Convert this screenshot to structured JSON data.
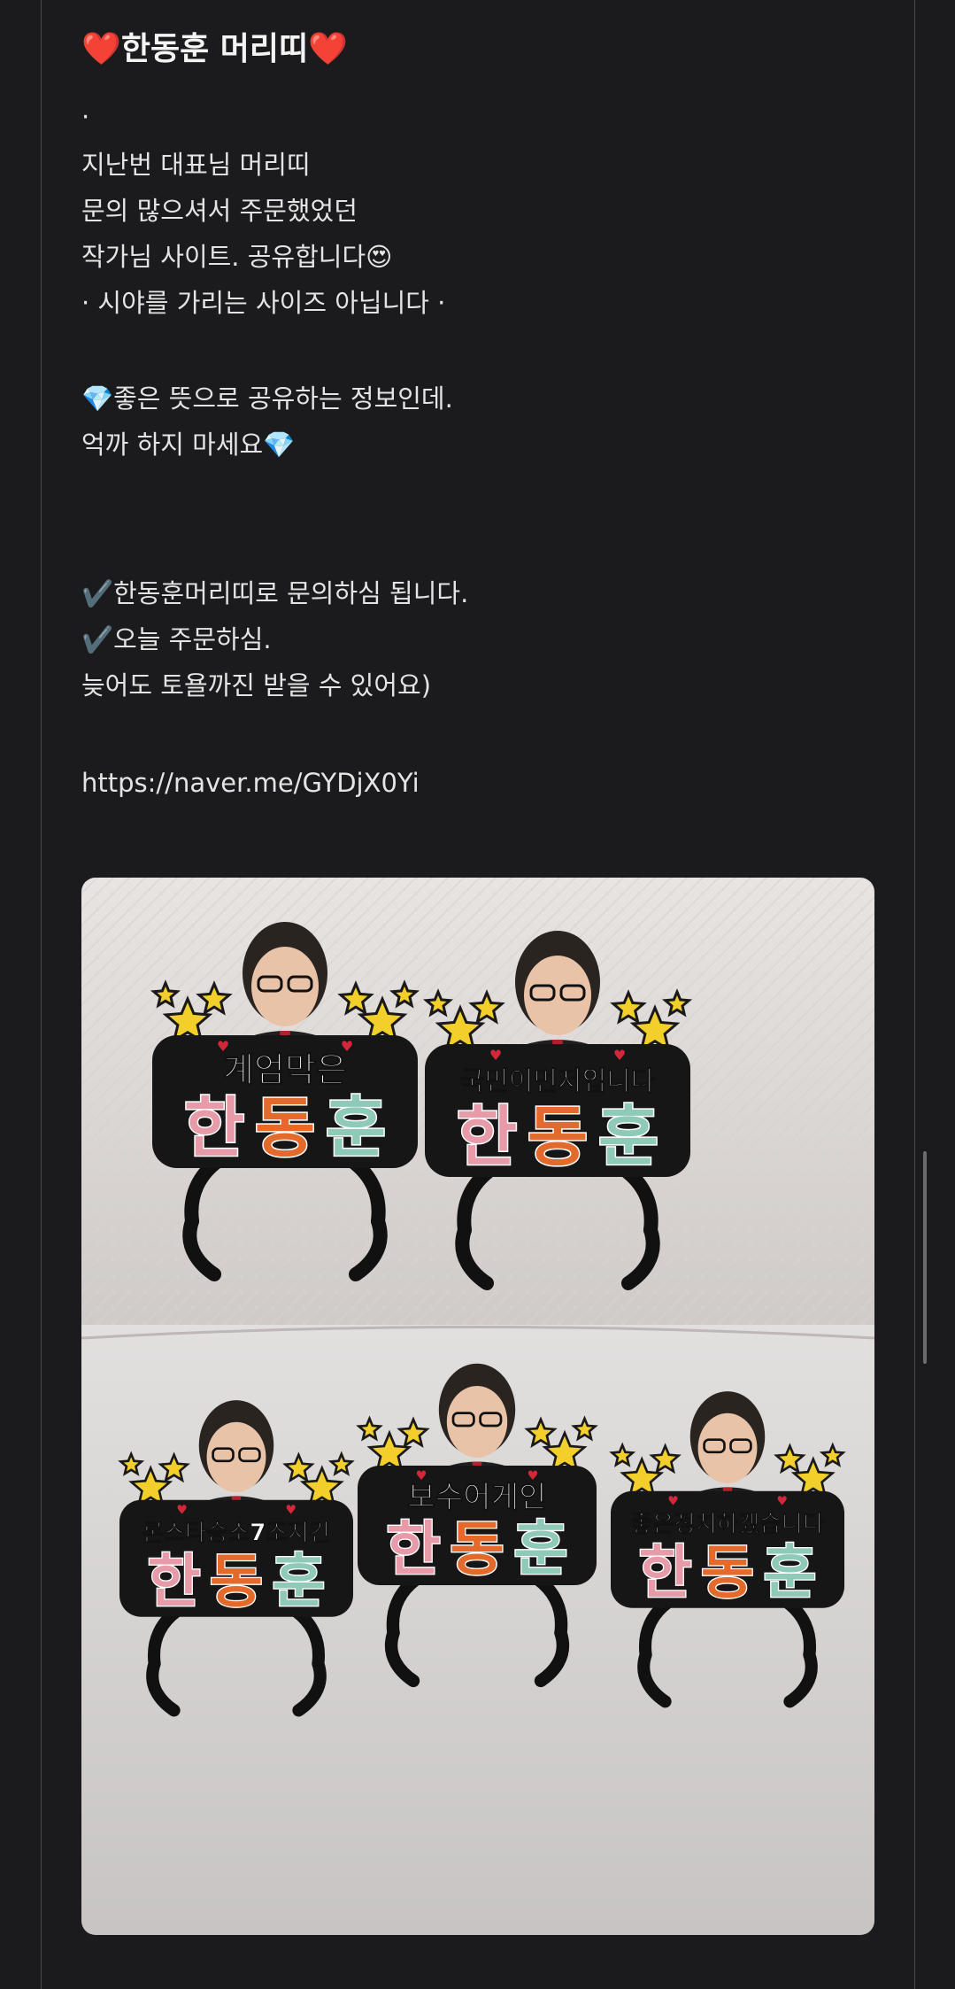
{
  "post": {
    "title": "❤️한동훈 머리띠❤️",
    "lines": [
      {
        "text": "·"
      },
      {
        "text": "지난번 대표님 머리띠"
      },
      {
        "text": "문의 많으셔서 주문했었던"
      },
      {
        "text": "작가님 사이트. 공유합니다😍"
      },
      {
        "text": "· 시야를 가리는 사이즈 아닙니다 ·"
      },
      {
        "text": "💎좋은 뜻으로 공유하는 정보인데."
      },
      {
        "text": "억까 하지 마세요💎"
      },
      {
        "text": "✔️한동훈머리띠로 문의하심 됩니다."
      },
      {
        "text": "✔️오늘 주문하심."
      },
      {
        "text": "늦어도 토욜까진 받을 수 있어요)"
      },
      {
        "text": "https://naver.me/GYDjX0Yi"
      }
    ]
  },
  "photo": {
    "headbands": [
      {
        "slogan": "계엄막은",
        "name": [
          "한",
          "동",
          "훈"
        ]
      },
      {
        "slogan": "국민이먼저입니다",
        "name": [
          "한",
          "동",
          "훈"
        ]
      },
      {
        "slogan": "론스타승소7조지킨",
        "name": [
          "한",
          "동",
          "훈"
        ]
      },
      {
        "slogan": "보수어게인",
        "name": [
          "한",
          "동",
          "훈"
        ]
      },
      {
        "slogan": "좋은정치하겠습니다",
        "name": [
          "한",
          "동",
          "훈"
        ]
      }
    ],
    "name_colors": [
      "#e79aa7",
      "#e46a2c",
      "#8fcab8"
    ]
  }
}
